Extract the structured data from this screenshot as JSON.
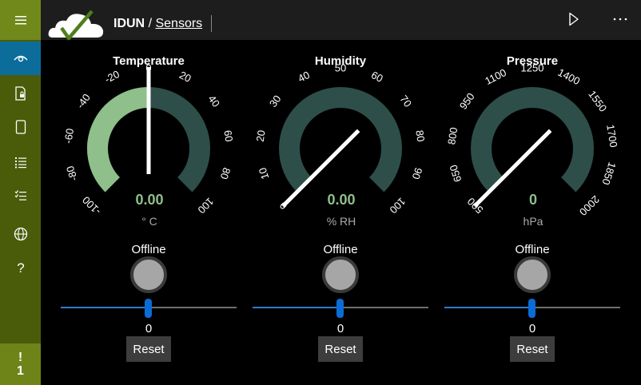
{
  "header": {
    "app_name": "IDUN",
    "separator": "/",
    "page_name": "Sensors"
  },
  "toolbar": {
    "play_icon": "play-icon",
    "more_icon": "more-icon"
  },
  "sidebar": {
    "items": [
      {
        "icon": "hamburger-menu-icon"
      },
      {
        "icon": "eye-icon",
        "active": true
      },
      {
        "icon": "document-lock-icon"
      },
      {
        "icon": "tablet-icon"
      },
      {
        "icon": "list-icon"
      },
      {
        "icon": "checklist-icon"
      },
      {
        "icon": "globe-icon"
      },
      {
        "icon": "help-icon"
      }
    ],
    "alert": {
      "symbol": "!",
      "count": "1"
    }
  },
  "gauges": [
    {
      "title": "Temperature",
      "min": -100,
      "max": 100,
      "ticks": [
        "-100",
        "-80",
        "-60",
        "-40",
        "-20",
        "0",
        "20",
        "40",
        "60",
        "80",
        "100"
      ],
      "value_text": "0.00",
      "unit": "° C",
      "needle_value": 0,
      "status": "Offline",
      "slider_value": "0",
      "reset_label": "Reset",
      "fill_color": "#8fbf8a",
      "track_color": "#2e4e4a",
      "value_color": "#8fbf8a"
    },
    {
      "title": "Humidity",
      "min": 0,
      "max": 100,
      "ticks": [
        "0",
        "10",
        "20",
        "30",
        "40",
        "50",
        "60",
        "70",
        "80",
        "90",
        "100"
      ],
      "value_text": "0.00",
      "unit": "% RH",
      "needle_value": 0,
      "status": "Offline",
      "slider_value": "0",
      "reset_label": "Reset",
      "fill_color": "#8fbf8a",
      "track_color": "#2e4e4a",
      "value_color": "#8fbf8a"
    },
    {
      "title": "Pressure",
      "min": 500,
      "max": 2000,
      "ticks": [
        "500",
        "650",
        "800",
        "950",
        "1100",
        "1250",
        "1400",
        "1550",
        "1700",
        "1850",
        "2000"
      ],
      "value_text": "0",
      "unit": "hPa",
      "needle_value": 500,
      "status": "Offline",
      "slider_value": "0",
      "reset_label": "Reset",
      "fill_color": "#8fbf8a",
      "track_color": "#2e4e4a",
      "value_color": "#8fbf8a"
    }
  ]
}
